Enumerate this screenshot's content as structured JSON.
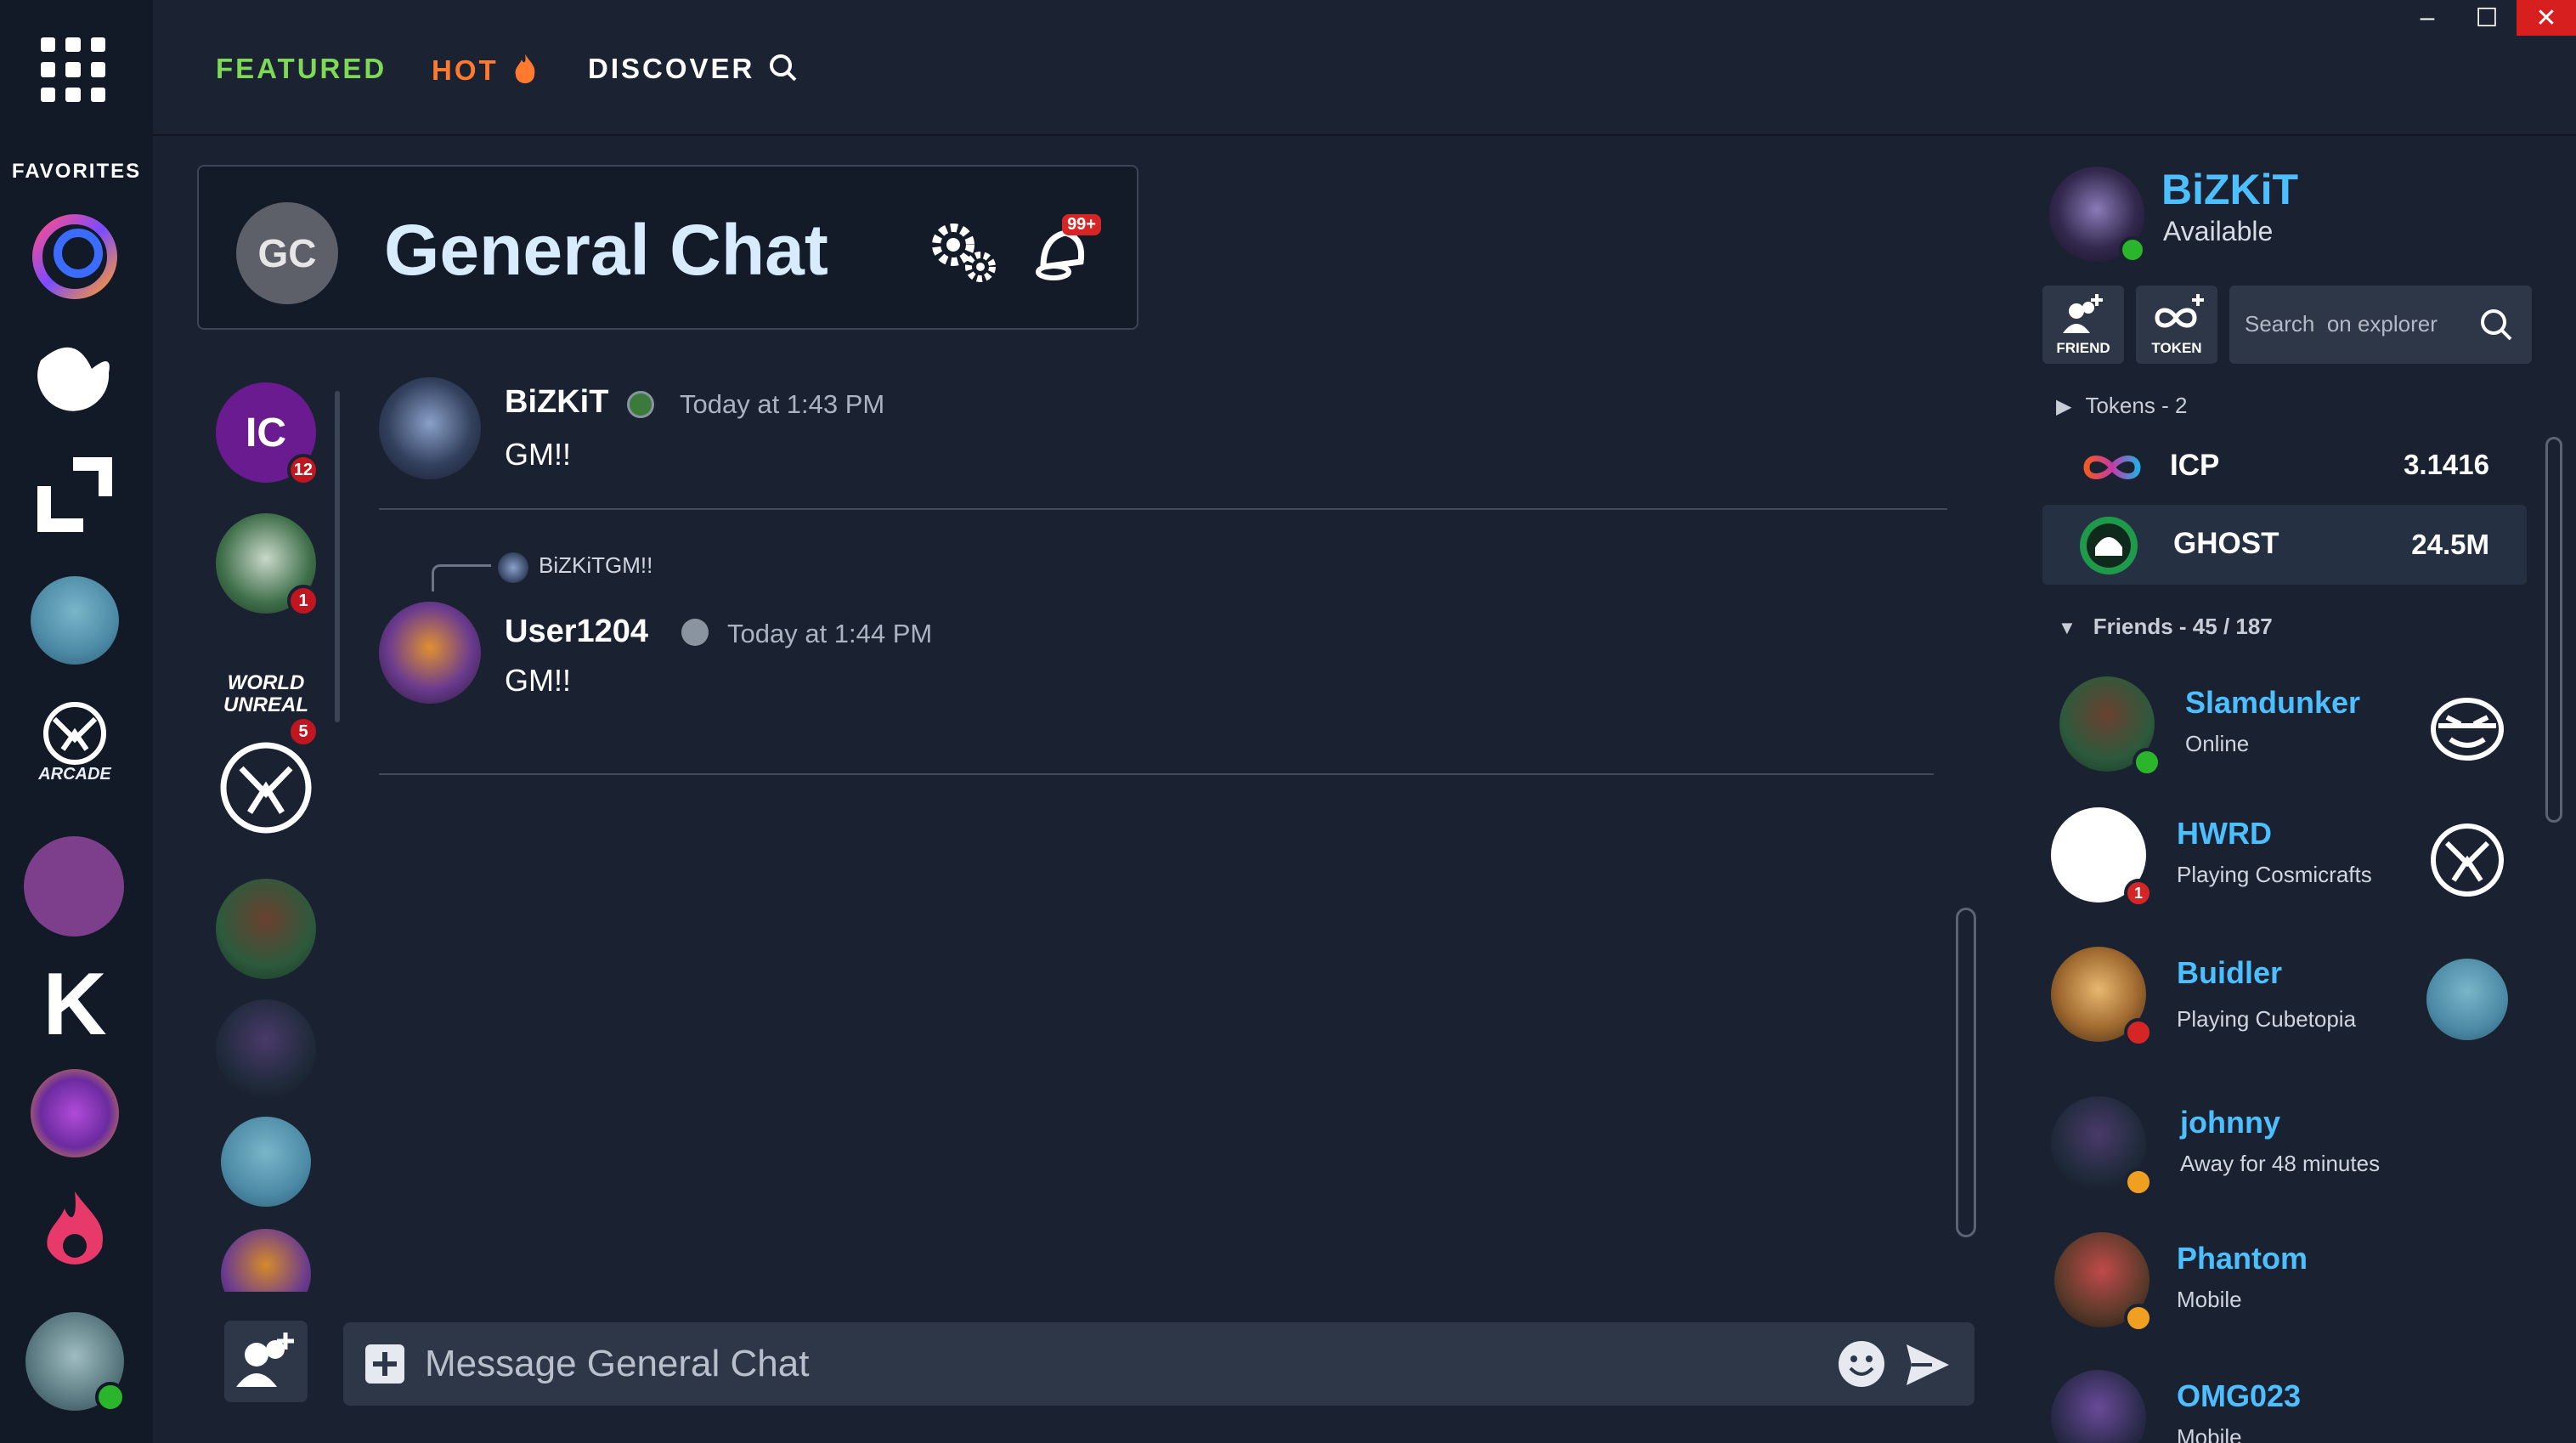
{
  "window": {
    "minimize": "–",
    "maximize": "☐",
    "close": "✕"
  },
  "nav": {
    "featured": "FEATURED",
    "hot": "HOT",
    "discover": "DISCOVER"
  },
  "sidebar": {
    "favorites_label": "FAVORITES",
    "arcade_label": "ARCADE",
    "k_label": "K",
    "apps": [
      "swirl-app-icon",
      "ghost-app-icon",
      "frame-app-icon",
      "cube-avatar-app-icon",
      "arcade-app-icon",
      "cat-app-icon",
      "k-app-icon",
      "fox-app-icon",
      "flame-app-icon",
      "troll-app-icon"
    ]
  },
  "chat": {
    "avatar_initials": "GC",
    "title": "General Chat",
    "notifications_badge": "99+"
  },
  "members": [
    {
      "initials": "IC",
      "badge": "12",
      "color": "#6a1b8f"
    },
    {
      "badge": "1"
    },
    {
      "wordmark": "WORLD UNREAL",
      "badge": "5"
    }
  ],
  "messages": [
    {
      "author": "BiZKiT",
      "time": "Today at 1:43 PM",
      "text": "GM!!"
    },
    {
      "reply_author": "BiZKiT",
      "reply_text": "GM!!",
      "author": "User1204",
      "time": "Today at 1:44 PM",
      "text": "GM!!"
    }
  ],
  "composer": {
    "placeholder": "Message General Chat"
  },
  "profile": {
    "name": "BiZKiT",
    "status": "Available"
  },
  "actions": {
    "friend": "FRIEND",
    "token": "TOKEN",
    "explorer_placeholder": "Search  on explorer"
  },
  "tokens": {
    "header": "Tokens - 2",
    "items": [
      {
        "name": "ICP",
        "value": "3.1416"
      },
      {
        "name": "GHOST",
        "value": "24.5M"
      }
    ]
  },
  "friends": {
    "header": "Friends - 45 / 187",
    "items": [
      {
        "name": "Slamdunker",
        "status": "Online",
        "dot": "#2ab52a"
      },
      {
        "name": "HWRD",
        "status": "Playing Cosmicrafts",
        "dot": "#d62525",
        "badge": "1"
      },
      {
        "name": "Buidler",
        "status": "Playing Cubetopia",
        "dot": "#d62525"
      },
      {
        "name": "johnny",
        "status": "Away for 48 minutes",
        "dot": "#f0a020"
      },
      {
        "name": "Phantom",
        "status": "Mobile",
        "dot": "#f0a020"
      },
      {
        "name": "OMG023",
        "status": "Mobile"
      }
    ]
  },
  "colors": {
    "accent": "#4dbfff",
    "featured": "#7ed957",
    "hot": "#ff7a2f",
    "background": "#1a2232"
  }
}
